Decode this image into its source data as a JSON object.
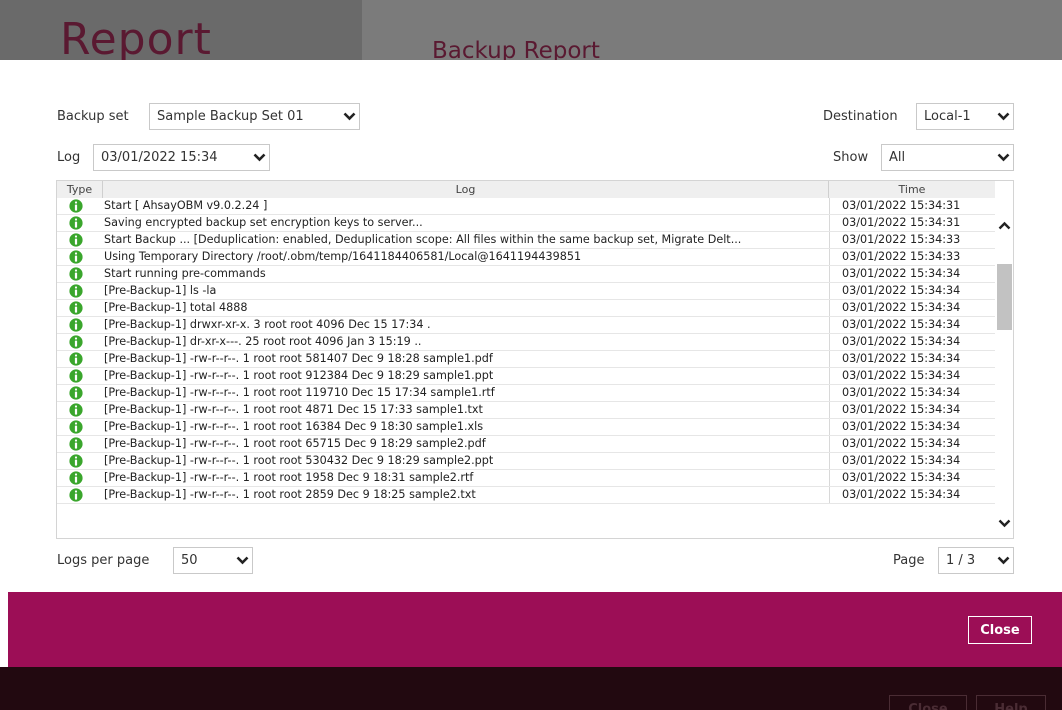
{
  "background": {
    "title": "Report",
    "subtitle": "Backup Report",
    "buttons": {
      "close": "Close",
      "help": "Help"
    }
  },
  "dialog": {
    "backup_set": {
      "label": "Backup set",
      "value": "Sample Backup Set 01"
    },
    "destination": {
      "label": "Destination",
      "value": "Local-1"
    },
    "log": {
      "label": "Log",
      "value": "03/01/2022 15:34"
    },
    "show": {
      "label": "Show",
      "value": "All"
    },
    "table": {
      "columns": {
        "type": "Type",
        "log": "Log",
        "time": "Time"
      },
      "rows": [
        {
          "type": "info",
          "log": "Start [ AhsayOBM v9.0.2.24 ]",
          "time": "03/01/2022 15:34:31"
        },
        {
          "type": "info",
          "log": "Saving encrypted backup set encryption keys to server...",
          "time": "03/01/2022 15:34:31"
        },
        {
          "type": "info",
          "log": "Start Backup ... [Deduplication: enabled, Deduplication scope: All files within the same backup set, Migrate Delt...",
          "time": "03/01/2022 15:34:33"
        },
        {
          "type": "info",
          "log": "Using Temporary Directory /root/.obm/temp/1641184406581/Local@1641194439851",
          "time": "03/01/2022 15:34:33"
        },
        {
          "type": "info",
          "log": "Start running pre-commands",
          "time": "03/01/2022 15:34:34"
        },
        {
          "type": "info",
          "log": "[Pre-Backup-1] ls -la",
          "time": "03/01/2022 15:34:34"
        },
        {
          "type": "info",
          "log": "[Pre-Backup-1] total 4888",
          "time": "03/01/2022 15:34:34"
        },
        {
          "type": "info",
          "log": "[Pre-Backup-1] drwxr-xr-x.  3 root root    4096 Dec 15 17:34 .",
          "time": "03/01/2022 15:34:34"
        },
        {
          "type": "info",
          "log": "[Pre-Backup-1] dr-xr-x---. 25 root root    4096 Jan  3 15:19 ..",
          "time": "03/01/2022 15:34:34"
        },
        {
          "type": "info",
          "log": "[Pre-Backup-1] -rw-r--r--.  1 root root  581407 Dec  9 18:28 sample1.pdf",
          "time": "03/01/2022 15:34:34"
        },
        {
          "type": "info",
          "log": "[Pre-Backup-1] -rw-r--r--.  1 root root  912384 Dec  9 18:29 sample1.ppt",
          "time": "03/01/2022 15:34:34"
        },
        {
          "type": "info",
          "log": "[Pre-Backup-1] -rw-r--r--.  1 root root  119710 Dec 15 17:34 sample1.rtf",
          "time": "03/01/2022 15:34:34"
        },
        {
          "type": "info",
          "log": "[Pre-Backup-1] -rw-r--r--.  1 root root    4871 Dec 15 17:33 sample1.txt",
          "time": "03/01/2022 15:34:34"
        },
        {
          "type": "info",
          "log": "[Pre-Backup-1] -rw-r--r--.  1 root root   16384 Dec  9 18:30 sample1.xls",
          "time": "03/01/2022 15:34:34"
        },
        {
          "type": "info",
          "log": "[Pre-Backup-1] -rw-r--r--.  1 root root   65715 Dec  9 18:29 sample2.pdf",
          "time": "03/01/2022 15:34:34"
        },
        {
          "type": "info",
          "log": "[Pre-Backup-1] -rw-r--r--.  1 root root  530432 Dec  9 18:29 sample2.ppt",
          "time": "03/01/2022 15:34:34"
        },
        {
          "type": "info",
          "log": "[Pre-Backup-1] -rw-r--r--.  1 root root    1958 Dec  9 18:31 sample2.rtf",
          "time": "03/01/2022 15:34:34"
        },
        {
          "type": "info",
          "log": "[Pre-Backup-1] -rw-r--r--.  1 root root    2859 Dec  9 18:25 sample2.txt",
          "time": "03/01/2022 15:34:34"
        }
      ]
    },
    "logs_per_page": {
      "label": "Logs per page",
      "value": "50"
    },
    "page": {
      "label": "Page",
      "value": "1 / 3"
    },
    "close_button": "Close"
  },
  "colors": {
    "accent": "#9c0e56",
    "info_icon": "#3aa62c"
  }
}
